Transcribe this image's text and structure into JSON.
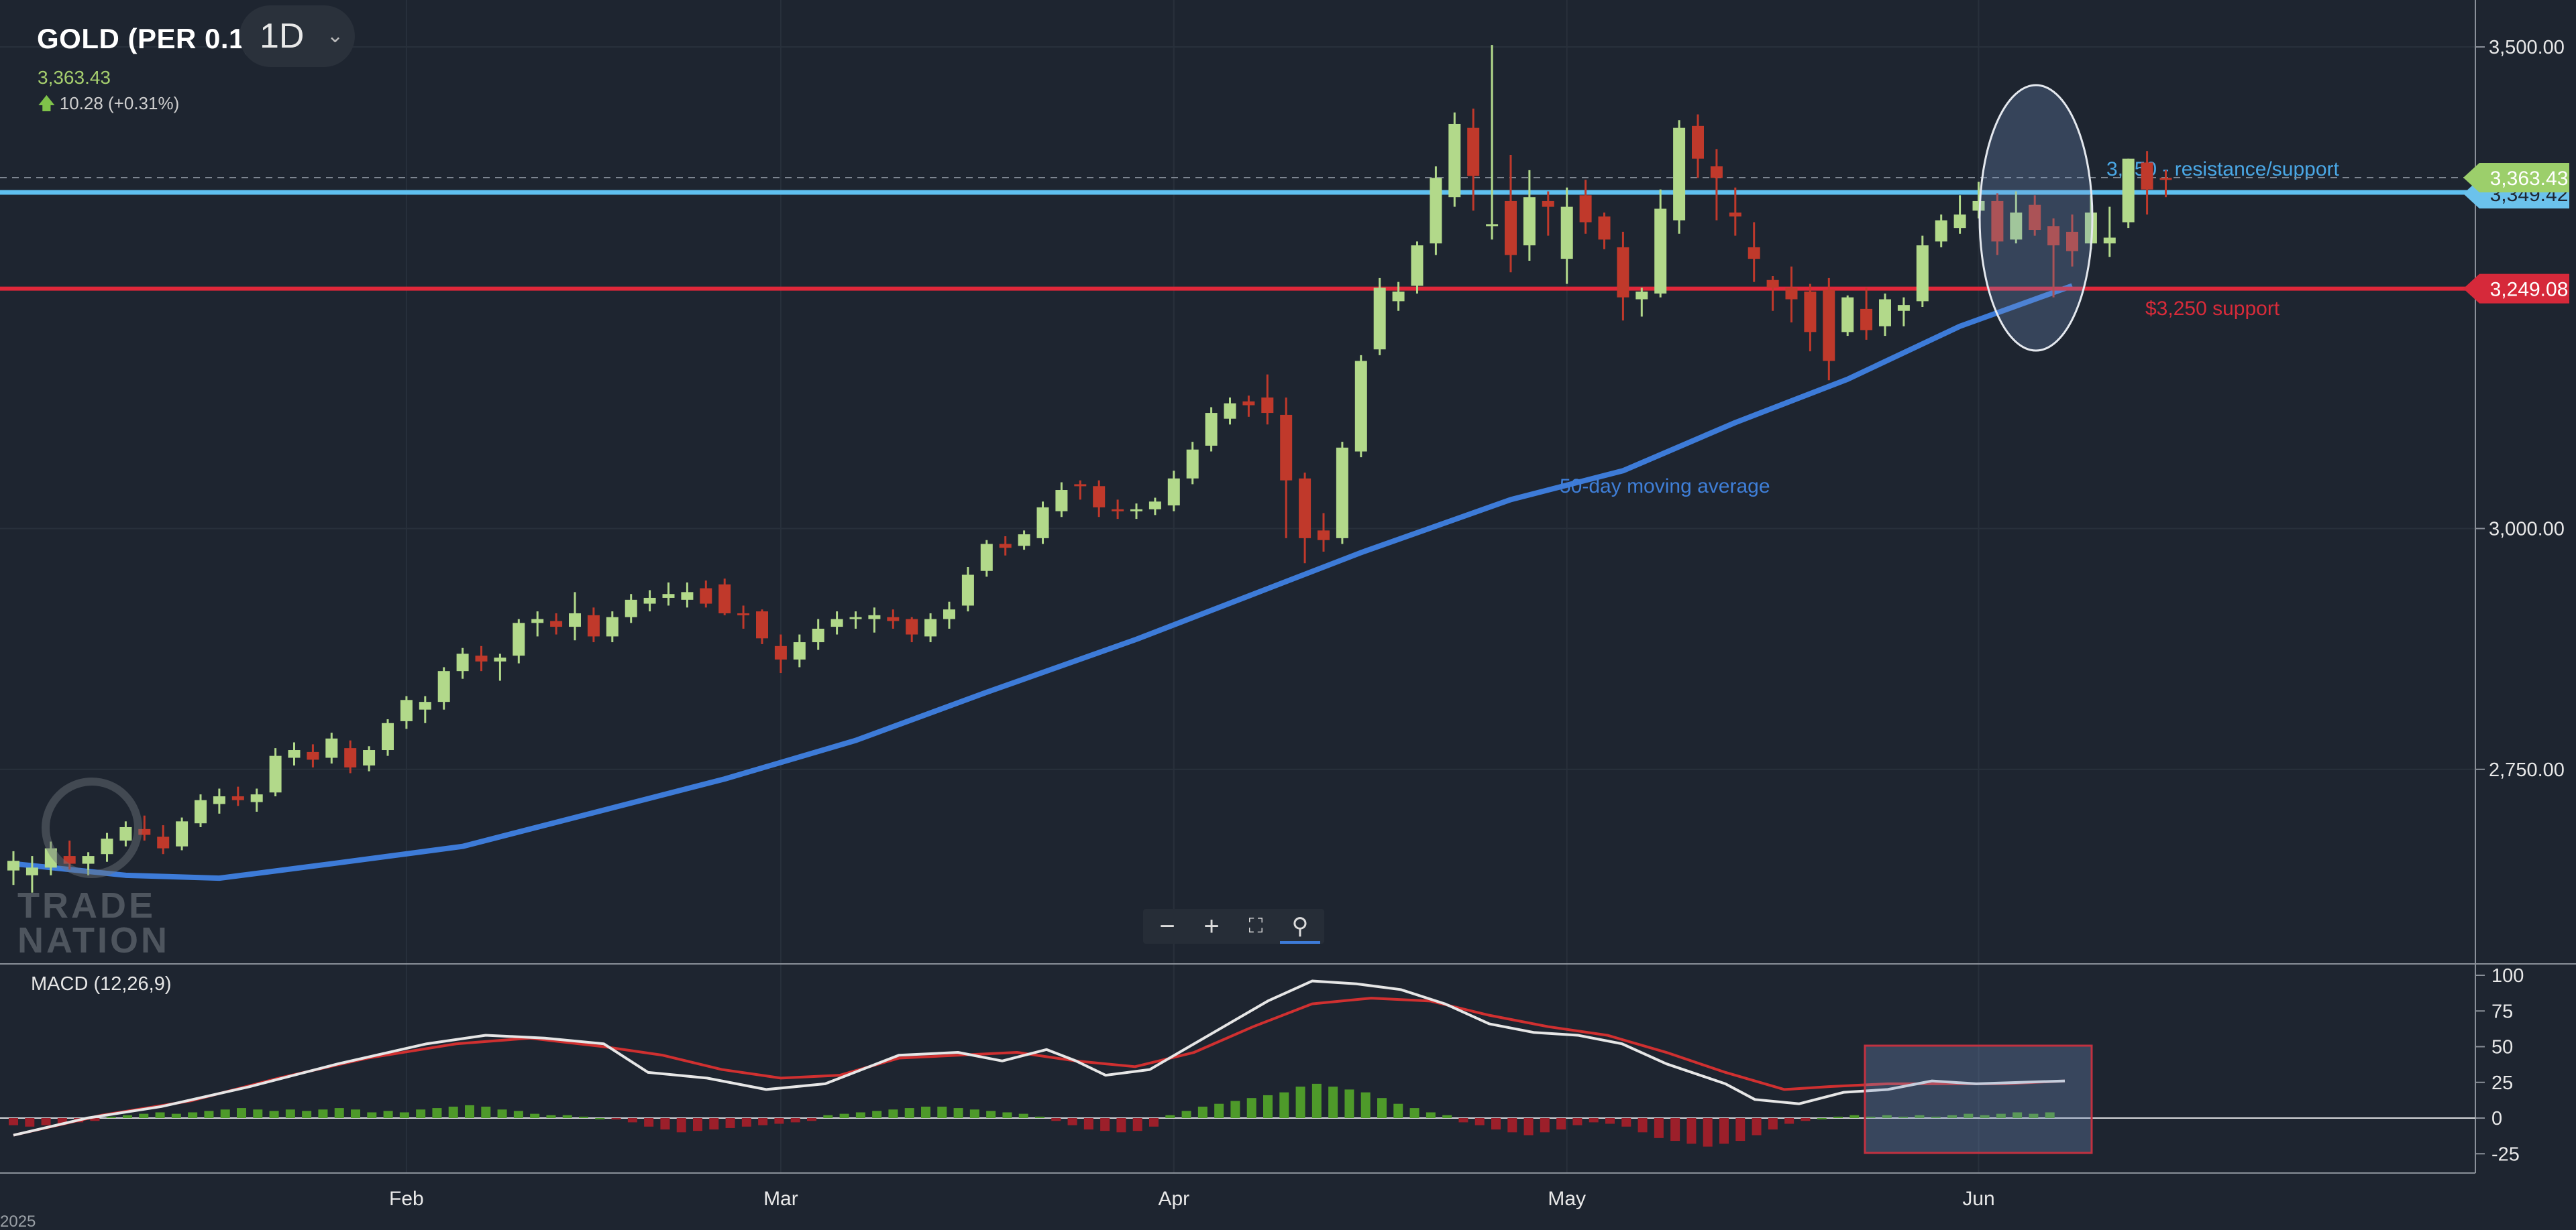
{
  "header": {
    "instrument": "GOLD (PER 0.1)",
    "timeframe": "1D",
    "price": "3,363.43",
    "change": "10.28 (+0.31%)"
  },
  "watermark": {
    "line1": "TRADE",
    "line2": "NATION"
  },
  "macd": {
    "label": "MACD (12,26,9)"
  },
  "colors": {
    "background": "#1e2530",
    "bull": "#b2d98a",
    "bear": "#c0392b",
    "ma": "#3d7bd8",
    "resistance": "#5fc0f0",
    "support": "#e0283a",
    "macd_line": "#e6e6e6",
    "signal_line": "#d03030",
    "hist_pos": "#4e9a2a",
    "hist_neg": "#9c1f2a"
  },
  "chart_data": [
    {
      "type": "candlestick",
      "title": "GOLD (PER 0.1)",
      "ylim": [
        2600,
        3530
      ],
      "y_ticks": [
        {
          "value": 3500,
          "label": "3,500.00"
        },
        {
          "value": 3000,
          "label": "3,000.00"
        },
        {
          "value": 2750,
          "label": "2,750.00"
        }
      ],
      "x_ticks": [
        {
          "index": 21,
          "label": "Feb"
        },
        {
          "index": 41,
          "label": "Mar"
        },
        {
          "index": 62,
          "label": "Apr"
        },
        {
          "index": 83,
          "label": "May"
        },
        {
          "index": 105,
          "label": "Jun"
        }
      ],
      "first_tick_label": "2025",
      "candles_ohlc": [
        [
          2645,
          2665,
          2630,
          2655
        ],
        [
          2640,
          2660,
          2622,
          2648
        ],
        [
          2648,
          2675,
          2640,
          2668
        ],
        [
          2660,
          2676,
          2646,
          2652
        ],
        [
          2652,
          2664,
          2640,
          2660
        ],
        [
          2662,
          2684,
          2654,
          2678
        ],
        [
          2676,
          2696,
          2670,
          2690
        ],
        [
          2688,
          2702,
          2676,
          2682
        ],
        [
          2680,
          2692,
          2662,
          2668
        ],
        [
          2670,
          2700,
          2666,
          2696
        ],
        [
          2694,
          2724,
          2690,
          2718
        ],
        [
          2714,
          2730,
          2704,
          2722
        ],
        [
          2722,
          2732,
          2712,
          2718
        ],
        [
          2716,
          2730,
          2706,
          2724
        ],
        [
          2726,
          2772,
          2722,
          2764
        ],
        [
          2762,
          2778,
          2754,
          2770
        ],
        [
          2768,
          2776,
          2752,
          2760
        ],
        [
          2762,
          2788,
          2756,
          2782
        ],
        [
          2772,
          2780,
          2746,
          2752
        ],
        [
          2754,
          2774,
          2748,
          2770
        ],
        [
          2770,
          2802,
          2764,
          2798
        ],
        [
          2800,
          2826,
          2792,
          2822
        ],
        [
          2812,
          2826,
          2798,
          2820
        ],
        [
          2820,
          2856,
          2812,
          2852
        ],
        [
          2852,
          2876,
          2844,
          2870
        ],
        [
          2868,
          2878,
          2852,
          2862
        ],
        [
          2862,
          2870,
          2842,
          2866
        ],
        [
          2868,
          2906,
          2860,
          2902
        ],
        [
          2902,
          2914,
          2888,
          2906
        ],
        [
          2904,
          2912,
          2890,
          2898
        ],
        [
          2898,
          2934,
          2884,
          2912
        ],
        [
          2910,
          2918,
          2882,
          2888
        ],
        [
          2888,
          2914,
          2882,
          2908
        ],
        [
          2908,
          2932,
          2902,
          2926
        ],
        [
          2922,
          2936,
          2914,
          2928
        ],
        [
          2928,
          2944,
          2920,
          2932
        ],
        [
          2926,
          2944,
          2918,
          2934
        ],
        [
          2938,
          2946,
          2918,
          2922
        ],
        [
          2942,
          2948,
          2910,
          2912
        ],
        [
          2912,
          2920,
          2896,
          2910
        ],
        [
          2914,
          2916,
          2880,
          2886
        ],
        [
          2878,
          2890,
          2850,
          2864
        ],
        [
          2864,
          2890,
          2856,
          2882
        ],
        [
          2882,
          2906,
          2874,
          2896
        ],
        [
          2898,
          2914,
          2890,
          2906
        ],
        [
          2908,
          2914,
          2896,
          2908
        ],
        [
          2906,
          2918,
          2892,
          2910
        ],
        [
          2908,
          2916,
          2896,
          2904
        ],
        [
          2906,
          2908,
          2882,
          2890
        ],
        [
          2888,
          2912,
          2882,
          2906
        ],
        [
          2906,
          2924,
          2896,
          2916
        ],
        [
          2920,
          2960,
          2914,
          2952
        ],
        [
          2956,
          2988,
          2950,
          2984
        ],
        [
          2984,
          2992,
          2972,
          2980
        ],
        [
          2982,
          2998,
          2978,
          2994
        ],
        [
          2990,
          3028,
          2984,
          3022
        ],
        [
          3018,
          3048,
          3012,
          3040
        ],
        [
          3046,
          3050,
          3030,
          3044
        ],
        [
          3044,
          3050,
          3012,
          3022
        ],
        [
          3020,
          3030,
          3010,
          3018
        ],
        [
          3018,
          3026,
          3010,
          3020
        ],
        [
          3020,
          3032,
          3014,
          3028
        ],
        [
          3024,
          3060,
          3018,
          3052
        ],
        [
          3052,
          3090,
          3046,
          3082
        ],
        [
          3086,
          3126,
          3080,
          3120
        ],
        [
          3114,
          3136,
          3108,
          3130
        ],
        [
          3132,
          3138,
          3116,
          3128
        ],
        [
          3136,
          3160,
          3108,
          3120
        ],
        [
          3118,
          3136,
          2990,
          3050
        ],
        [
          3052,
          3058,
          2964,
          2990
        ],
        [
          2998,
          3016,
          2976,
          2988
        ],
        [
          2990,
          3090,
          2984,
          3084
        ],
        [
          3080,
          3180,
          3074,
          3174
        ],
        [
          3186,
          3260,
          3180,
          3250
        ],
        [
          3236,
          3256,
          3226,
          3246
        ],
        [
          3252,
          3298,
          3244,
          3294
        ],
        [
          3296,
          3376,
          3284,
          3364
        ],
        [
          3344,
          3432,
          3334,
          3420
        ],
        [
          3416,
          3436,
          3330,
          3366
        ],
        [
          3316,
          3502,
          3300,
          3316
        ],
        [
          3340,
          3388,
          3266,
          3284
        ],
        [
          3294,
          3372,
          3278,
          3344
        ],
        [
          3340,
          3350,
          3304,
          3334
        ],
        [
          3280,
          3354,
          3254,
          3334
        ],
        [
          3346,
          3362,
          3306,
          3318
        ],
        [
          3324,
          3328,
          3290,
          3300
        ],
        [
          3292,
          3308,
          3216,
          3240
        ],
        [
          3238,
          3250,
          3220,
          3246
        ],
        [
          3244,
          3352,
          3240,
          3332
        ],
        [
          3320,
          3424,
          3306,
          3416
        ],
        [
          3418,
          3430,
          3364,
          3384
        ],
        [
          3376,
          3394,
          3320,
          3364
        ],
        [
          3328,
          3354,
          3304,
          3324
        ],
        [
          3292,
          3318,
          3256,
          3280
        ],
        [
          3258,
          3262,
          3226,
          3250
        ],
        [
          3250,
          3272,
          3214,
          3238
        ],
        [
          3246,
          3254,
          3184,
          3204
        ],
        [
          3248,
          3260,
          3154,
          3174
        ],
        [
          3204,
          3242,
          3200,
          3240
        ],
        [
          3228,
          3250,
          3196,
          3206
        ],
        [
          3210,
          3244,
          3200,
          3238
        ],
        [
          3226,
          3240,
          3210,
          3232
        ],
        [
          3236,
          3304,
          3230,
          3294
        ],
        [
          3298,
          3326,
          3292,
          3320
        ],
        [
          3312,
          3346,
          3306,
          3326
        ],
        [
          3330,
          3360,
          3322,
          3340
        ],
        [
          3340,
          3348,
          3284,
          3298
        ],
        [
          3300,
          3350,
          3296,
          3328
        ],
        [
          3336,
          3346,
          3304,
          3310
        ],
        [
          3314,
          3322,
          3240,
          3294
        ],
        [
          3308,
          3326,
          3272,
          3288
        ],
        [
          3296,
          3346,
          3290,
          3328
        ],
        [
          3296,
          3334,
          3282,
          3302
        ],
        [
          3318,
          3384,
          3312,
          3384
        ],
        [
          3380,
          3392,
          3326,
          3352
        ],
        [
          3364,
          3372,
          3344,
          3362
        ]
      ],
      "ma_label": "50-day moving average",
      "ma_values": [
        [
          0,
          2652
        ],
        [
          6,
          2640
        ],
        [
          11,
          2637
        ],
        [
          17,
          2652
        ],
        [
          24,
          2670
        ],
        [
          30,
          2700
        ],
        [
          38,
          2740
        ],
        [
          45,
          2780
        ],
        [
          52,
          2830
        ],
        [
          60,
          2885
        ],
        [
          66,
          2930
        ],
        [
          72,
          2975
        ],
        [
          80,
          3030
        ],
        [
          86,
          3060
        ],
        [
          92,
          3110
        ],
        [
          98,
          3155
        ],
        [
          104,
          3210
        ],
        [
          110,
          3252
        ]
      ],
      "horizontal_lines": [
        {
          "name": "3,350 - resistance/support",
          "value": 3350,
          "badge": "3,349.42"
        },
        {
          "name": "$3,250 support",
          "value": 3249.08,
          "badge": "3,249.08"
        }
      ],
      "current_price": {
        "value": 3363.43,
        "badge": "3,363.43"
      }
    },
    {
      "type": "bar+line",
      "title": "MACD (12,26,9)",
      "ylim": [
        -30,
        105
      ],
      "y_ticks": [
        100,
        75,
        50,
        25,
        0,
        -25
      ],
      "macd_line": [
        [
          0,
          -12
        ],
        [
          5,
          0
        ],
        [
          10,
          8
        ],
        [
          16,
          22
        ],
        [
          22,
          38
        ],
        [
          28,
          52
        ],
        [
          32,
          58
        ],
        [
          36,
          56
        ],
        [
          40,
          52
        ],
        [
          43,
          32
        ],
        [
          47,
          28
        ],
        [
          51,
          20
        ],
        [
          55,
          24
        ],
        [
          60,
          44
        ],
        [
          64,
          46
        ],
        [
          67,
          40
        ],
        [
          70,
          48
        ],
        [
          72,
          40
        ],
        [
          74,
          30
        ],
        [
          77,
          34
        ],
        [
          80,
          52
        ],
        [
          82,
          64
        ],
        [
          85,
          82
        ],
        [
          88,
          96
        ],
        [
          91,
          94
        ],
        [
          94,
          90
        ],
        [
          97,
          80
        ],
        [
          100,
          66
        ],
        [
          103,
          60
        ],
        [
          106,
          58
        ],
        [
          109,
          52
        ],
        [
          112,
          38
        ],
        [
          116,
          24
        ],
        [
          118,
          13
        ],
        [
          121,
          10
        ],
        [
          124,
          18
        ],
        [
          127,
          20
        ],
        [
          130,
          26
        ],
        [
          133,
          24
        ],
        [
          136,
          25
        ],
        [
          139,
          26
        ]
      ],
      "signal_line": [
        [
          0,
          -12
        ],
        [
          6,
          2
        ],
        [
          12,
          12
        ],
        [
          18,
          28
        ],
        [
          24,
          42
        ],
        [
          30,
          52
        ],
        [
          35,
          56
        ],
        [
          40,
          50
        ],
        [
          44,
          44
        ],
        [
          48,
          34
        ],
        [
          52,
          28
        ],
        [
          56,
          30
        ],
        [
          60,
          42
        ],
        [
          64,
          44
        ],
        [
          68,
          46
        ],
        [
          72,
          40
        ],
        [
          76,
          36
        ],
        [
          80,
          46
        ],
        [
          84,
          64
        ],
        [
          88,
          80
        ],
        [
          92,
          84
        ],
        [
          96,
          82
        ],
        [
          100,
          72
        ],
        [
          104,
          64
        ],
        [
          108,
          58
        ],
        [
          112,
          46
        ],
        [
          116,
          32
        ],
        [
          120,
          20
        ],
        [
          123,
          22
        ],
        [
          127,
          24
        ],
        [
          131,
          24
        ],
        [
          135,
          24
        ],
        [
          139,
          26
        ]
      ],
      "histogram": [
        -5,
        -6,
        -5,
        -4,
        -3,
        -2,
        1,
        2,
        3,
        4,
        3,
        4,
        5,
        6,
        7,
        6,
        5,
        6,
        5,
        6,
        7,
        6,
        4,
        5,
        4,
        6,
        7,
        8,
        9,
        8,
        6,
        5,
        3,
        2,
        2,
        1,
        0,
        -1,
        -3,
        -6,
        -8,
        -10,
        -9,
        -8,
        -7,
        -6,
        -5,
        -4,
        -3,
        -2,
        2,
        3,
        4,
        5,
        6,
        7,
        8,
        8,
        7,
        6,
        5,
        4,
        3,
        1,
        -2,
        -5,
        -8,
        -9,
        -10,
        -9,
        -6,
        2,
        5,
        8,
        10,
        12,
        14,
        16,
        18,
        22,
        24,
        22,
        20,
        18,
        14,
        10,
        7,
        4,
        2,
        -3,
        -5,
        -8,
        -10,
        -12,
        -10,
        -8,
        -5,
        -3,
        -4,
        -6,
        -10,
        -14,
        -16,
        -18,
        -20,
        -18,
        -16,
        -12,
        -8,
        -4,
        -2,
        0,
        1,
        2,
        1,
        2,
        1,
        2,
        1,
        2,
        3,
        2,
        3,
        4,
        3,
        4
      ],
      "highlight_box_x": [
        125,
        144
      ]
    }
  ]
}
